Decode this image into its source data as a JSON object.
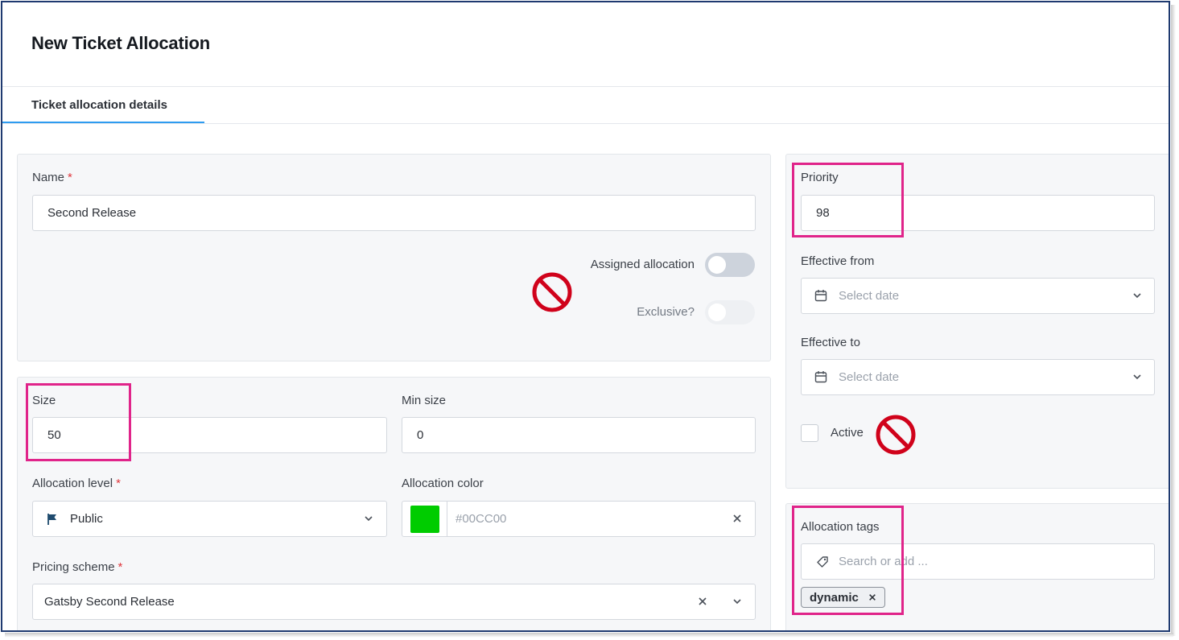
{
  "header": {
    "title": "New Ticket Allocation"
  },
  "tabs": [
    {
      "label": "Ticket allocation details",
      "active": true
    }
  ],
  "left_top": {
    "name_label": "Name",
    "name_value": "Second Release",
    "assigned_allocation_label": "Assigned allocation",
    "exclusive_label": "Exclusive?"
  },
  "left_bottom": {
    "size_label": "Size",
    "size_value": "50",
    "min_size_label": "Min size",
    "min_size_value": "0",
    "allocation_level_label": "Allocation level",
    "allocation_level_value": "Public",
    "allocation_color_label": "Allocation color",
    "allocation_color_value": "#00CC00",
    "pricing_scheme_label": "Pricing scheme",
    "pricing_scheme_value": "Gatsby Second Release"
  },
  "right_top": {
    "priority_label": "Priority",
    "priority_value": "98",
    "effective_from_label": "Effective from",
    "effective_from_placeholder": "Select date",
    "effective_to_label": "Effective to",
    "effective_to_placeholder": "Select date",
    "active_label": "Active"
  },
  "right_bottom": {
    "tags_label": "Allocation tags",
    "tags_placeholder": "Search or add ...",
    "tags": [
      "dynamic"
    ]
  },
  "required_marker": "*",
  "colors": {
    "accent_tab": "#2e9cf0",
    "highlight": "#e0248a",
    "no_sign": "#d0021b",
    "swatch": "#00CC00",
    "required": "#e0383e"
  }
}
